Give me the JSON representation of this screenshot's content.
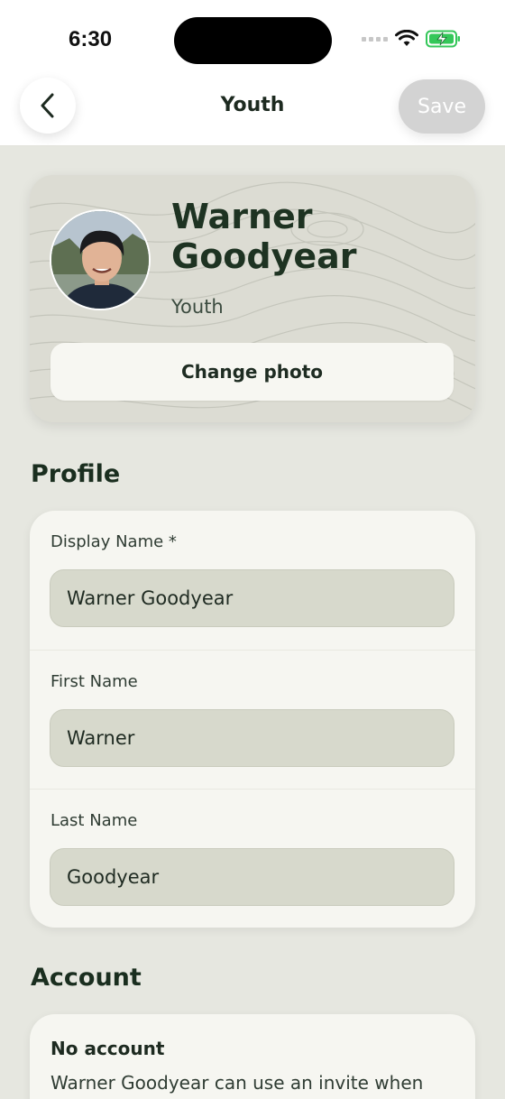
{
  "status_bar": {
    "time": "6:30"
  },
  "nav": {
    "title": "Youth",
    "save_label": "Save"
  },
  "hero": {
    "name": "Warner Goodyear",
    "name_line1": "Warner",
    "name_line2": "Goodyear",
    "role": "Youth",
    "change_photo_label": "Change photo"
  },
  "profile": {
    "title": "Profile",
    "fields": [
      {
        "label": "Display Name *",
        "value": "Warner Goodyear"
      },
      {
        "label": "First Name",
        "value": "Warner"
      },
      {
        "label": "Last Name",
        "value": "Goodyear"
      }
    ]
  },
  "account": {
    "title": "Account",
    "status": "No account",
    "description": "Warner Goodyear can use an invite when"
  },
  "colors": {
    "background": "#e6e7e0",
    "card": "#f6f6f1",
    "input": "#d7d9cc",
    "heading": "#1a2e1f",
    "save_disabled": "#d3d3d3",
    "battery": "#34c759"
  }
}
